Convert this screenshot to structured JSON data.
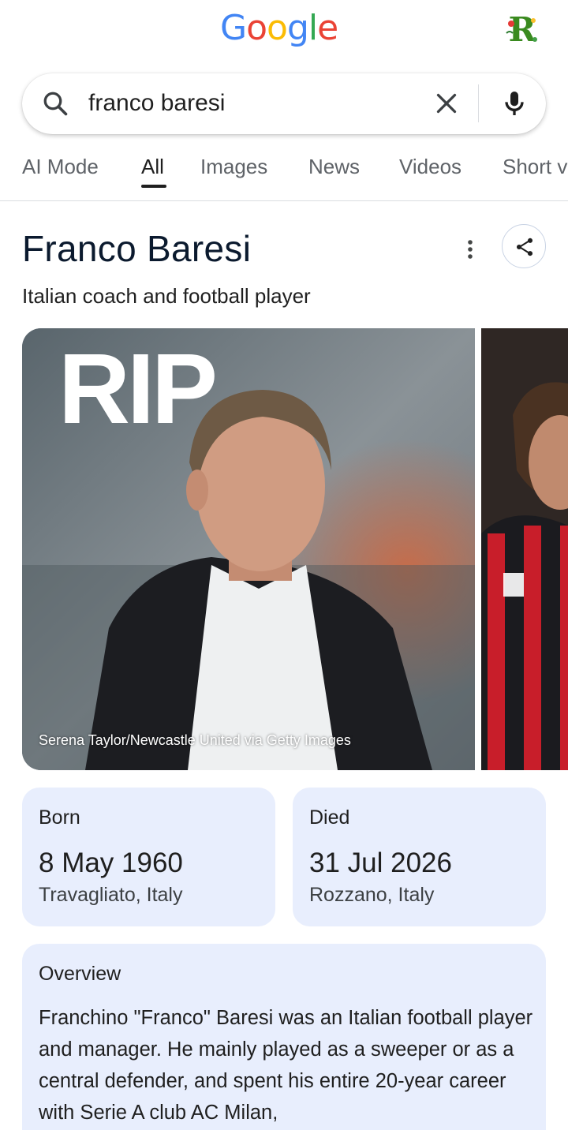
{
  "header": {
    "logo_letters": [
      {
        "char": "G",
        "color": "#4285F4"
      },
      {
        "char": "o",
        "color": "#EA4335"
      },
      {
        "char": "o",
        "color": "#FBBC05"
      },
      {
        "char": "g",
        "color": "#4285F4"
      },
      {
        "char": "l",
        "color": "#34A853"
      },
      {
        "char": "e",
        "color": "#EA4335"
      }
    ],
    "avatar_letter": "R"
  },
  "search": {
    "query": "franco baresi",
    "search_icon": "search-icon",
    "clear_icon": "close-icon",
    "mic_icon": "microphone-icon"
  },
  "tabs": [
    {
      "label": "AI Mode",
      "active": false
    },
    {
      "label": "All",
      "active": true
    },
    {
      "label": "Images",
      "active": false
    },
    {
      "label": "News",
      "active": false
    },
    {
      "label": "Videos",
      "active": false
    },
    {
      "label": "Short v",
      "active": false
    }
  ],
  "knowledge_panel": {
    "title": "Franco Baresi",
    "subtitle": "Italian coach and football player",
    "more_icon": "more-vertical-icon",
    "share_icon": "share-icon",
    "images": {
      "main_overlay_text": "RIP",
      "main_credit": "Serena Taylor/Newcastle United via Getty Images"
    },
    "born": {
      "label": "Born",
      "date": "8 May 1960",
      "place": "Travagliato, Italy"
    },
    "died": {
      "label": "Died",
      "date": "31 Jul 2026",
      "place": "Rozzano, Italy"
    },
    "overview": {
      "label": "Overview",
      "text": "Franchino \"Franco\" Baresi was an Italian football player and manager. He mainly played as a sweeper or as a central defender, and spent his entire 20-year career with Serie A club AC Milan,"
    }
  },
  "colors": {
    "card_bg": "#e8eefd",
    "tab_active": "#1f1f1f",
    "tab_inactive": "#5f6368"
  }
}
